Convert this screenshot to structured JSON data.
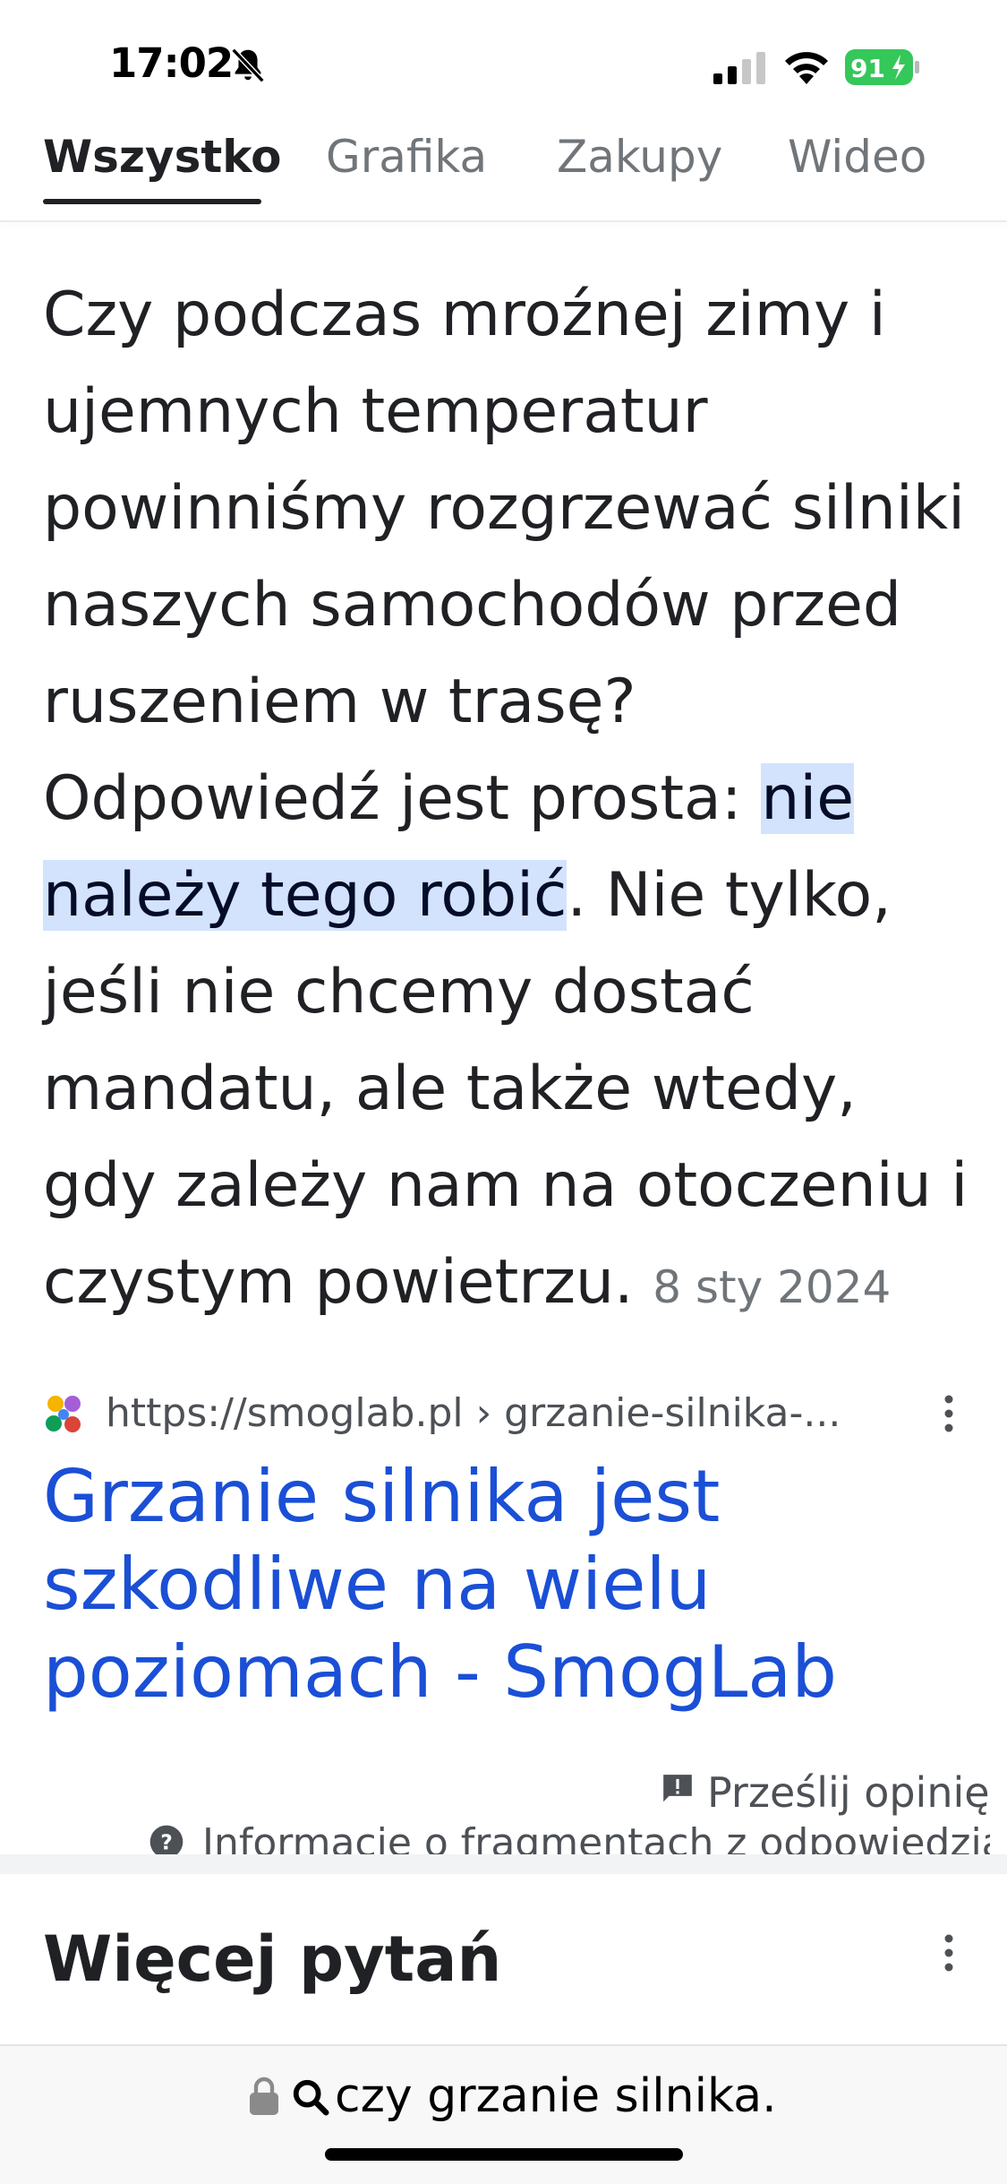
{
  "status_bar": {
    "time": "17:02",
    "battery_level": "91"
  },
  "tabs": [
    {
      "label": "Wszystko",
      "active": true
    },
    {
      "label": "Grafika",
      "active": false
    },
    {
      "label": "Zakupy",
      "active": false
    },
    {
      "label": "Wideo",
      "active": false
    }
  ],
  "answer": {
    "text_before": "Czy podczas mroźnej zimy i ujemnych temperatur powinniśmy rozgrzewać silniki naszych samochodów przed ruszeniem w trasę? Odpowiedź jest prosta: ",
    "highlight": "nie należy tego robić",
    "text_after": ". Nie tylko, jeśli nie chcemy dostać mandatu, ale także wtedy, gdy zależy nam na otoczeniu i czystym powietrzu.",
    "date": "8 sty 2024"
  },
  "source": {
    "url": "https://smoglab.pl › grzanie-silnika-...",
    "title": "Grzanie silnika jest szkodliwe na wielu poziomach - SmogLab"
  },
  "feedback": {
    "label": "Prześlij opinię",
    "info_label": "Informacje o fragmentach z odpowiedzią"
  },
  "more_questions": {
    "title": "Więcej pytań"
  },
  "address_bar": {
    "text": "czy grzanie silnika."
  },
  "colors": {
    "link": "#1a4fd6",
    "highlight_bg": "#d3e3fd",
    "battery_green": "#34c759"
  }
}
